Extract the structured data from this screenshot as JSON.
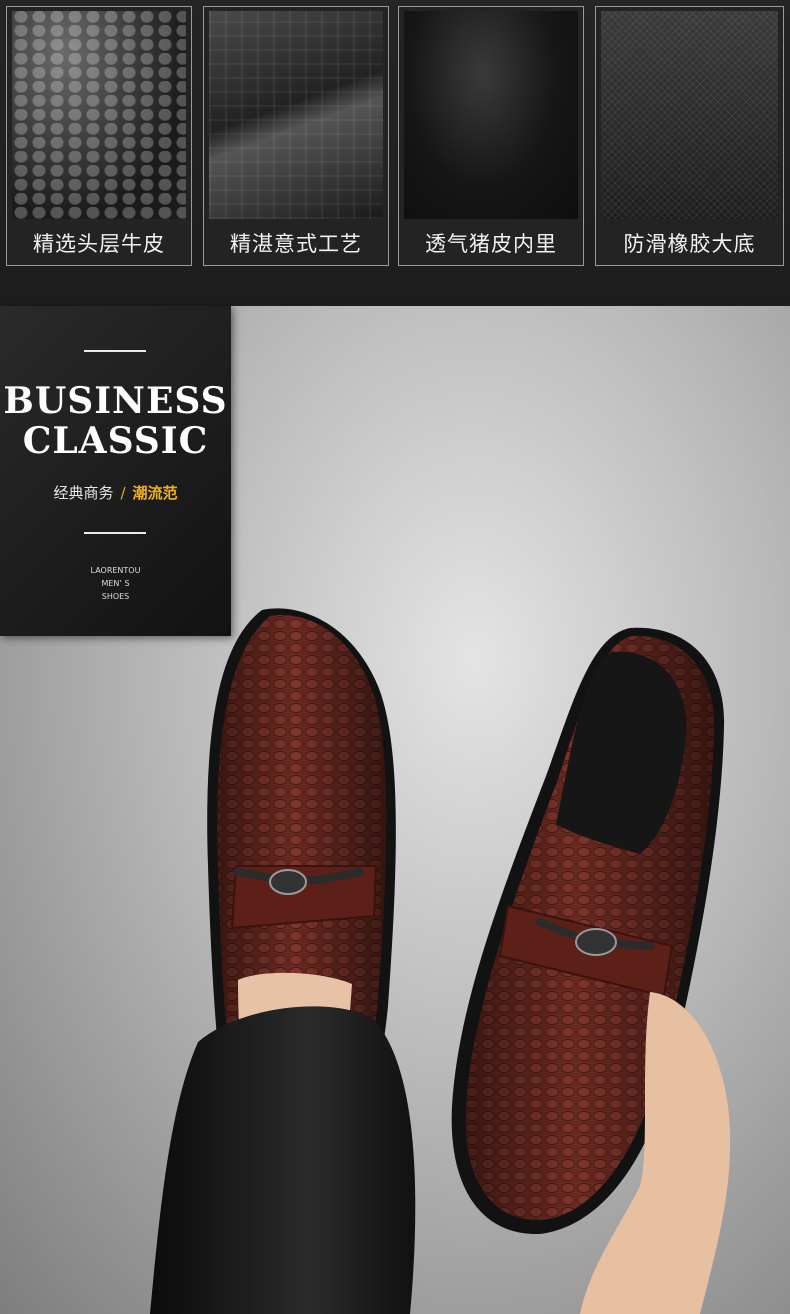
{
  "features": [
    {
      "label": "精选头层牛皮",
      "icon": "croc-leather-closeup"
    },
    {
      "label": "精湛意式工艺",
      "icon": "stitching-closeup"
    },
    {
      "label": "透气猪皮内里",
      "icon": "lining-closeup"
    },
    {
      "label": "防滑橡胶大底",
      "icon": "sole-closeup"
    }
  ],
  "banner": {
    "title_line1": "BUSINESS",
    "title_line2": "CLASSIC",
    "subtitle_cn": "经典商务",
    "separator": "/",
    "highlight_cn": "潮流范",
    "brand_line1": "LAORENTOU",
    "brand_line2": "MEN’ S",
    "brand_line3": "SHOES"
  },
  "colors": {
    "accent": "#f2b21b",
    "leather": "#6e2a22",
    "background": "#1c1c1c"
  }
}
